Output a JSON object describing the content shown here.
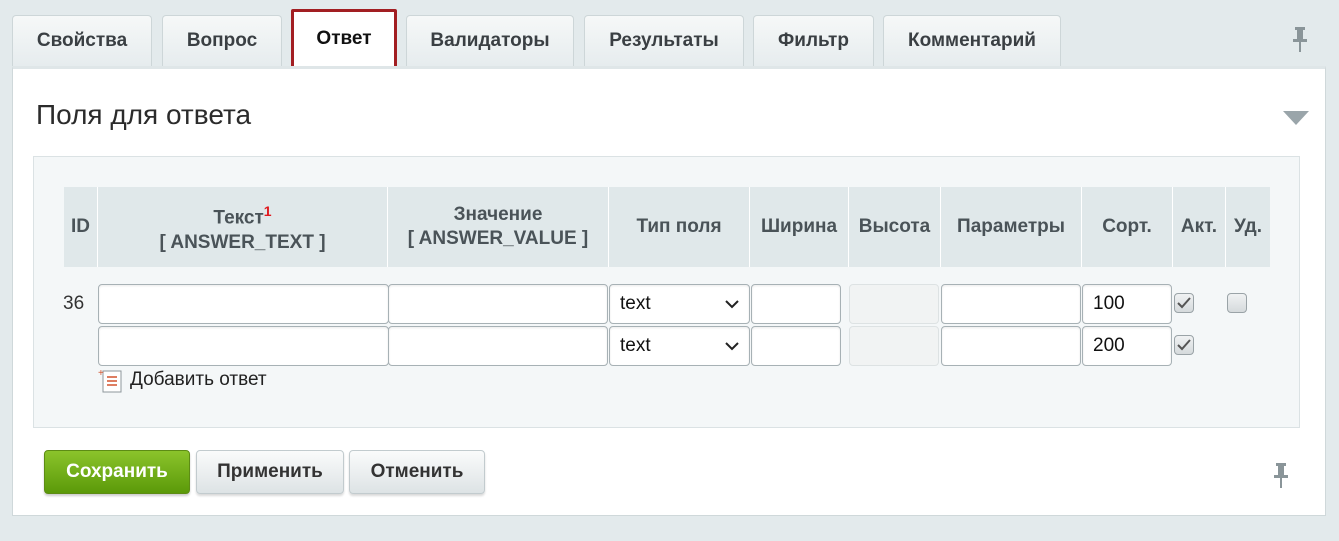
{
  "tabs": [
    {
      "label": "Свойства",
      "active": false
    },
    {
      "label": "Вопрос",
      "active": false
    },
    {
      "label": "Ответ",
      "active": true
    },
    {
      "label": "Валидаторы",
      "active": false
    },
    {
      "label": "Результаты",
      "active": false
    },
    {
      "label": "Фильтр",
      "active": false
    },
    {
      "label": "Комментарий",
      "active": false
    }
  ],
  "section": {
    "title": "Поля для ответа"
  },
  "table": {
    "headers": {
      "id": "ID",
      "text": "Текст",
      "text_note": "1",
      "text_code": "[ ANSWER_TEXT ]",
      "value": "Значение",
      "value_code": "[ ANSWER_VALUE ]",
      "field_type": "Тип поля",
      "width": "Ширина",
      "height": "Высота",
      "params": "Параметры",
      "sort": "Сорт.",
      "active": "Акт.",
      "delete": "Уд."
    },
    "rows": [
      {
        "id": "36",
        "text": "",
        "value": "",
        "field_type": "text",
        "width": "",
        "height": "",
        "params": "",
        "sort": "100",
        "active": true,
        "delete": false
      },
      {
        "id": "",
        "text": "",
        "value": "",
        "field_type": "text",
        "width": "",
        "height": "",
        "params": "",
        "sort": "200",
        "active": true,
        "delete": null
      }
    ],
    "add_answer_label": "Добавить ответ"
  },
  "buttons": {
    "save": "Сохранить",
    "apply": "Применить",
    "cancel": "Отменить"
  },
  "colors": {
    "active_tab_border": "#a21e22",
    "save_button": "#6fab14"
  }
}
